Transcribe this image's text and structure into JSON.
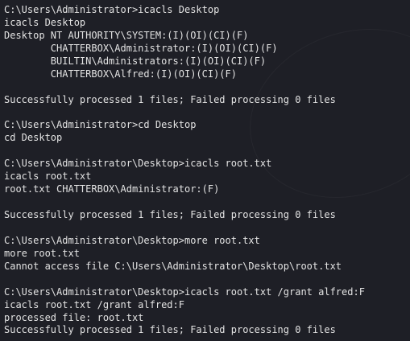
{
  "terminal": {
    "lines": [
      "C:\\Users\\Administrator>icacls Desktop",
      "icacls Desktop",
      "Desktop NT AUTHORITY\\SYSTEM:(I)(OI)(CI)(F)",
      "        CHATTERBOX\\Administrator:(I)(OI)(CI)(F)",
      "        BUILTIN\\Administrators:(I)(OI)(CI)(F)",
      "        CHATTERBOX\\Alfred:(I)(OI)(CI)(F)",
      "",
      "Successfully processed 1 files; Failed processing 0 files",
      "",
      "C:\\Users\\Administrator>cd Desktop",
      "cd Desktop",
      "",
      "C:\\Users\\Administrator\\Desktop>icacls root.txt",
      "icacls root.txt",
      "root.txt CHATTERBOX\\Administrator:(F)",
      "",
      "Successfully processed 1 files; Failed processing 0 files",
      "",
      "C:\\Users\\Administrator\\Desktop>more root.txt",
      "more root.txt",
      "Cannot access file C:\\Users\\Administrator\\Desktop\\root.txt",
      "",
      "C:\\Users\\Administrator\\Desktop>icacls root.txt /grant alfred:F",
      "icacls root.txt /grant alfred:F",
      "processed file: root.txt",
      "Successfully processed 1 files; Failed processing 0 files"
    ]
  }
}
